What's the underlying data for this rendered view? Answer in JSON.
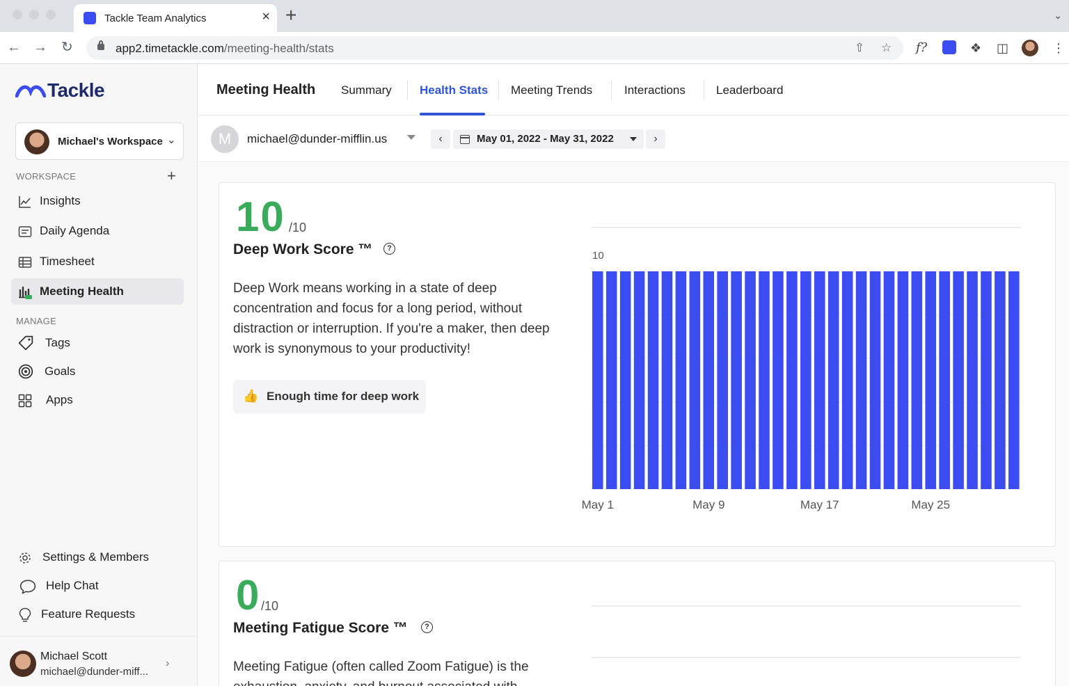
{
  "browser": {
    "tab_title": "Tackle Team Analytics",
    "new_tab_label": "+",
    "url_host": "app2.timetackle.com",
    "url_path": "/meeting-health/stats",
    "ext_formula_label": "f?"
  },
  "sidebar": {
    "logo_text": "Tackle",
    "workspace_name": "Michael's Workspace",
    "section_workspace": "WORKSPACE",
    "section_manage": "MANAGE",
    "workspace_items": [
      {
        "label": "Insights",
        "icon": "line-chart-icon"
      },
      {
        "label": "Daily Agenda",
        "icon": "agenda-icon"
      },
      {
        "label": "Timesheet",
        "icon": "table-icon"
      },
      {
        "label": "Meeting Health",
        "icon": "bar-chart-icon",
        "active": true
      }
    ],
    "manage_items": [
      {
        "label": "Tags",
        "icon": "tag-icon"
      },
      {
        "label": "Goals",
        "icon": "target-icon"
      },
      {
        "label": "Apps",
        "icon": "apps-grid-icon"
      }
    ],
    "bottom_items": [
      {
        "label": "Settings & Members",
        "icon": "gear-icon"
      },
      {
        "label": "Help Chat",
        "icon": "chat-bubble-icon"
      },
      {
        "label": "Feature Requests",
        "icon": "lightbulb-icon"
      }
    ],
    "user": {
      "name": "Michael Scott",
      "email": "michael@dunder-miff..."
    }
  },
  "main": {
    "title": "Meeting Health",
    "tabs": [
      {
        "label": "Summary"
      },
      {
        "label": "Health Stats",
        "active": true
      },
      {
        "label": "Meeting Trends"
      },
      {
        "label": "Interactions"
      },
      {
        "label": "Leaderboard"
      }
    ],
    "filter": {
      "avatar_letter": "M",
      "email": "michael@dunder-mifflin.us",
      "date_range": "May 01, 2022 - May 31, 2022"
    },
    "cards": [
      {
        "score": "10",
        "max": "/10",
        "title": "Deep Work Score ™",
        "description": "Deep Work means working in a state of deep concentration and focus for a long period, without distraction or interruption. If you're a maker, then deep work is synonymous to your productivity!",
        "pill_text": "Enough time for deep work",
        "pill_icon": "thumbs-up-icon"
      },
      {
        "score": "0",
        "max": "/10",
        "title": "Meeting Fatigue Score ™",
        "description": "Meeting Fatigue (often called Zoom Fatigue) is the exhaustion, anxiety, and burnout associated with"
      }
    ]
  },
  "colors": {
    "brand": "#3b4cf0",
    "bar": "#3b4cf0",
    "score_green": "#3aab5a",
    "tab_active": "#2f55d4"
  },
  "chart_data": {
    "type": "bar",
    "x": [
      "May 1",
      "May 2",
      "May 3",
      "May 4",
      "May 5",
      "May 6",
      "May 7",
      "May 8",
      "May 9",
      "May 10",
      "May 11",
      "May 12",
      "May 13",
      "May 14",
      "May 15",
      "May 16",
      "May 17",
      "May 18",
      "May 19",
      "May 20",
      "May 21",
      "May 22",
      "May 23",
      "May 24",
      "May 25",
      "May 26",
      "May 27",
      "May 28",
      "May 29",
      "May 30",
      "May 31"
    ],
    "values": [
      10,
      10,
      10,
      10,
      10,
      10,
      10,
      10,
      10,
      10,
      10,
      10,
      10,
      10,
      10,
      10,
      10,
      10,
      10,
      10,
      10,
      10,
      10,
      10,
      10,
      10,
      10,
      10,
      10,
      10,
      10
    ],
    "tick_labels": [
      "May 1",
      "May 9",
      "May 17",
      "May 25"
    ],
    "data_label": "10",
    "ylim": [
      0,
      10
    ],
    "grid": true
  }
}
